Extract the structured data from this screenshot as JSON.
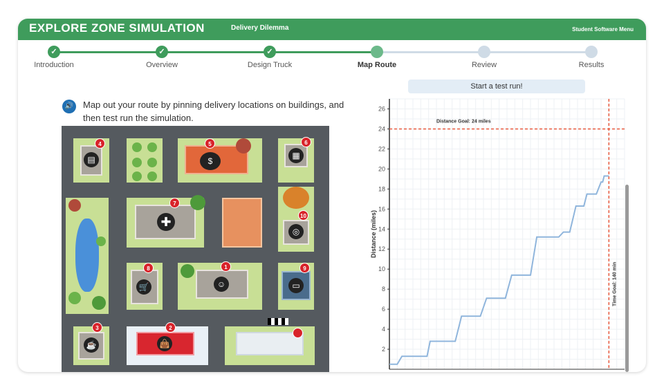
{
  "header": {
    "title": "EXPLORE ZONE SIMULATION",
    "subtitle": "Delivery Dilemma",
    "menu": "Student Software Menu"
  },
  "steps": [
    {
      "label": "Introduction",
      "state": "done"
    },
    {
      "label": "Overview",
      "state": "done"
    },
    {
      "label": "Design Truck",
      "state": "done"
    },
    {
      "label": "Map Route",
      "state": "current"
    },
    {
      "label": "Review",
      "state": "todo"
    },
    {
      "label": "Results",
      "state": "todo"
    }
  ],
  "instructions": "Map out your route by pinning delivery locations on buildings, and then test run the simulation.",
  "map": {
    "pins": [
      "1",
      "2",
      "3",
      "4",
      "5",
      "6",
      "7",
      "8",
      "9",
      "10"
    ]
  },
  "start_button": "Start a test run!",
  "chart_data": {
    "type": "line",
    "ylabel": "Distance (miles)",
    "xlabel": "",
    "ylim": [
      0,
      27
    ],
    "yticks": [
      2,
      4,
      6,
      8,
      10,
      12,
      14,
      16,
      18,
      20,
      22,
      24,
      26
    ],
    "xlim": [
      0,
      150
    ],
    "series": [
      {
        "x": [
          0,
          5,
          8,
          12,
          24,
          26,
          30,
          42,
          46,
          50,
          58,
          62,
          66,
          74,
          78,
          82,
          90,
          94,
          98,
          108,
          111,
          115,
          119,
          124,
          126,
          132,
          135,
          136,
          137,
          140
        ],
        "values": [
          0.5,
          0.5,
          1.3,
          1.3,
          1.3,
          2.8,
          2.8,
          2.8,
          5.3,
          5.3,
          5.3,
          7.1,
          7.1,
          7.1,
          9.4,
          9.4,
          9.4,
          13.2,
          13.2,
          13.2,
          13.7,
          13.7,
          16.3,
          16.3,
          17.5,
          17.5,
          18.7,
          18.7,
          19.3,
          19.3
        ]
      }
    ],
    "goal_lines": [
      {
        "axis": "y",
        "value": 24,
        "label": "Distance Goal: 24 miles",
        "color": "#e8583c"
      },
      {
        "axis": "x",
        "value": 140,
        "label": "Time Goal: 140 min",
        "color": "#e8583c"
      }
    ],
    "grid": true,
    "line_color": "#8fb5dc"
  }
}
